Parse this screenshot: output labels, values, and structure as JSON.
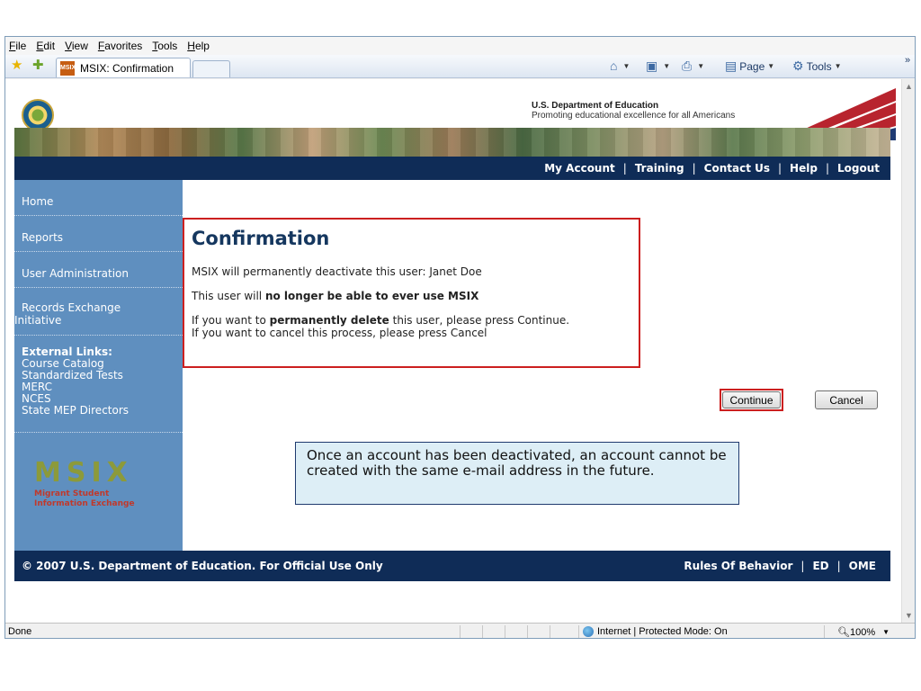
{
  "browser": {
    "menu": [
      "File",
      "Edit",
      "View",
      "Favorites",
      "Tools",
      "Help"
    ],
    "tab_title": "MSIX: Confirmation",
    "favicon_text": "MSIX",
    "commands": {
      "page": "Page",
      "tools": "Tools"
    },
    "chevron": "»",
    "status": {
      "left": "Done",
      "zone": "Internet | Protected Mode: On",
      "zoom": "100%"
    }
  },
  "site": {
    "dept_name": "U.S. Department of Education",
    "dept_tagline": "Promoting educational excellence for all Americans",
    "topnav": [
      "My Account",
      "Training",
      "Contact Us",
      "Help",
      "Logout"
    ],
    "sidebar": {
      "items": [
        "Home",
        "Reports",
        "User Administration"
      ],
      "records_line1": "Records Exchange",
      "records_line2": "Initiative",
      "external_title": "External Links:",
      "external_links": [
        "Course Catalog",
        "Standardized Tests",
        "MERC",
        "NCES",
        "State MEP Directors"
      ]
    },
    "logo": {
      "letters": "MSIX",
      "line1": "Migrant Student",
      "line2": "Information Exchange"
    },
    "confirmation": {
      "title": "Confirmation",
      "line1": "MSIX will permanently deactivate this user: Janet Doe",
      "line2_pre": "This user will ",
      "line2_bold": "no longer be able to ever use MSIX",
      "line3_pre": "If you want to ",
      "line3_bold": "permanently delete",
      "line3_post": " this user, please press Continue.",
      "line4": "If you want to cancel this process, please press Cancel"
    },
    "buttons": {
      "continue": "Continue",
      "cancel": "Cancel"
    },
    "note": "Once an account has been deactivated, an account cannot be created with the same e-mail address in the future.",
    "footer": {
      "copyright": "© 2007 U.S. Department of Education. For Official Use Only",
      "links": [
        "Rules Of Behavior",
        "ED",
        "OME"
      ]
    }
  }
}
